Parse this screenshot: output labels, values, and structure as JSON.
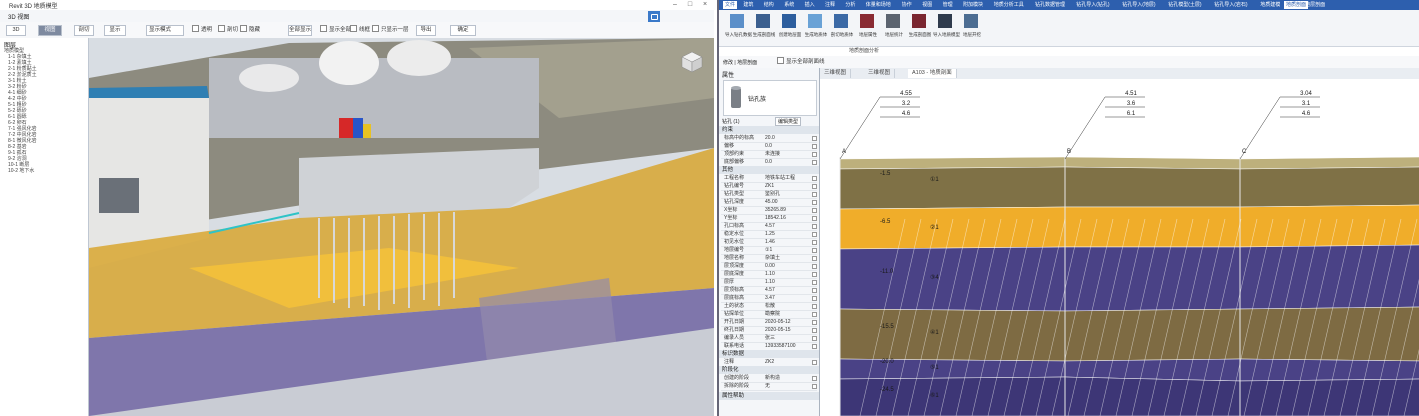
{
  "left_window": {
    "title": "Revit 3D 地质模型",
    "toolbar1": {
      "left_label": "3D 视图"
    },
    "toolbar2": {
      "buttons": [
        "3D",
        "视图",
        "剖切",
        "显示",
        "全部显示"
      ],
      "dropdown_value": "显示模式",
      "checks": [
        "透明",
        "剖切",
        "隐藏",
        "显示全部",
        "线框",
        "只显示一层",
        "导出"
      ],
      "extra_buttons": [
        "确定",
        "帮助"
      ]
    },
    "tree": {
      "header": "图层",
      "items": [
        "地质模型",
        "1-1 杂填土",
        "1-2 素填土",
        "2-1 粉质黏土",
        "2-2 淤泥质土",
        "3-1 粉土",
        "3-2 粉砂",
        "4-1 细砂",
        "4-2 中砂",
        "5-1 粗砂",
        "5-2 砾砂",
        "6-1 圆砾",
        "6-2 卵石",
        "7-1 强风化岩",
        "7-2 中风化岩",
        "8-1 微风化岩",
        "8-2 基岩",
        "9-1 孤石",
        "9-2 溶洞",
        "10-1 断层",
        "10-2 地下水"
      ]
    }
  },
  "right_window": {
    "ribbon_tabs": [
      "文件",
      "建筑",
      "结构",
      "系统",
      "插入",
      "注释",
      "分析",
      "体量和场地",
      "协作",
      "视图",
      "管理",
      "附加模块",
      "地质分析工具",
      "钻孔数据管理",
      "钻孔导入(钻孔)",
      "钻孔导入(地层)",
      "钻孔模型(土层)",
      "钻孔导入(岩石)",
      "地质建模",
      "修改 | 地层剖面"
    ],
    "active_tab": "地质剖面",
    "ribbon_buttons": [
      "导入钻孔数据",
      "生成剖面线",
      "创建地层面",
      "生成地质体",
      "剖切地质体",
      "地层属性",
      "地层统计",
      "生成剖面图",
      "导入地质模型",
      "地层开挖"
    ],
    "ribbon_subtitle": "地质剖面分析",
    "options": {
      "label": "修改 | 地层剖面",
      "check": "显示全部剖面线"
    },
    "properties": {
      "header": "属性",
      "type_name": "钻孔族",
      "edit_type": "编辑类型",
      "selector": "钻孔 (1)",
      "sections": [
        {
          "title": "约束",
          "rows": [
            [
              "标高中的标高",
              "20.0"
            ],
            [
              "偏移",
              "0.0"
            ],
            [
              "顶部约束",
              "未连接"
            ],
            [
              "底部偏移",
              "0.0"
            ]
          ]
        },
        {
          "title": "其他",
          "rows": [
            [
              "工程名称",
              "地铁车站工程"
            ],
            [
              "钻孔编号",
              "ZK1"
            ],
            [
              "钻孔类型",
              "鉴别孔"
            ],
            [
              "钻孔深度",
              "45.00"
            ],
            [
              "X坐标",
              "35265.89"
            ],
            [
              "Y坐标",
              "18542.16"
            ],
            [
              "孔口标高",
              "4.57"
            ],
            [
              "稳定水位",
              "1.25"
            ],
            [
              "初见水位",
              "1.46"
            ],
            [
              "地层编号",
              "①1"
            ],
            [
              "地层名称",
              "杂填土"
            ],
            [
              "层顶深度",
              "0.00"
            ],
            [
              "层底深度",
              "1.10"
            ],
            [
              "层厚",
              "1.10"
            ],
            [
              "层顶标高",
              "4.57"
            ],
            [
              "层底标高",
              "3.47"
            ],
            [
              "土的状态",
              "松散"
            ],
            [
              "钻探单位",
              "勘察院"
            ],
            [
              "开孔日期",
              "2020-05-12"
            ],
            [
              "终孔日期",
              "2020-05-15"
            ],
            [
              "编录人员",
              "张三"
            ],
            [
              "联系电话",
              "13933587100"
            ]
          ]
        },
        {
          "title": "标识数据",
          "rows": [
            [
              "注释",
              "ZK2"
            ]
          ]
        },
        {
          "title": "阶段化",
          "rows": [
            [
              "创建的阶段",
              "新构造"
            ],
            [
              "拆除的阶段",
              "无"
            ]
          ]
        }
      ],
      "footer": "属性帮助"
    },
    "doc_tabs": [
      "三维视图",
      "三维视图",
      "A103 - 地质剖面"
    ],
    "section": {
      "boreholes": [
        {
          "id": "A",
          "labels": [
            "4.55",
            "3.2",
            "4.6"
          ]
        },
        {
          "id": "B",
          "labels": [
            "4.51",
            "3.6",
            "6.1"
          ]
        },
        {
          "id": "C",
          "labels": [
            "3.04",
            "3.1",
            "4.6"
          ]
        }
      ],
      "layer_labels": [
        "①1",
        "②1",
        "③4",
        "④1",
        "⑤1",
        "⑥1"
      ],
      "depth_labels": [
        "-1.5",
        "-6.5",
        "-11.0",
        "-15.5",
        "-20.0",
        "-24.5"
      ],
      "colors": {
        "ground": "#bdb07c",
        "layer1": "#7f7146",
        "layer2": "#f0ad2a",
        "layer3": "#4a4286",
        "layer4": "#7e6b43",
        "layer5": "#4a4286"
      }
    }
  },
  "viewport": {
    "colors": {
      "sky": "#dfe6ee",
      "ground": "#8c8c7a",
      "sand": "#d9a930",
      "slab": "#c9ccd1",
      "clay": "#7a6ea7",
      "water": "#4f8fb7"
    }
  }
}
